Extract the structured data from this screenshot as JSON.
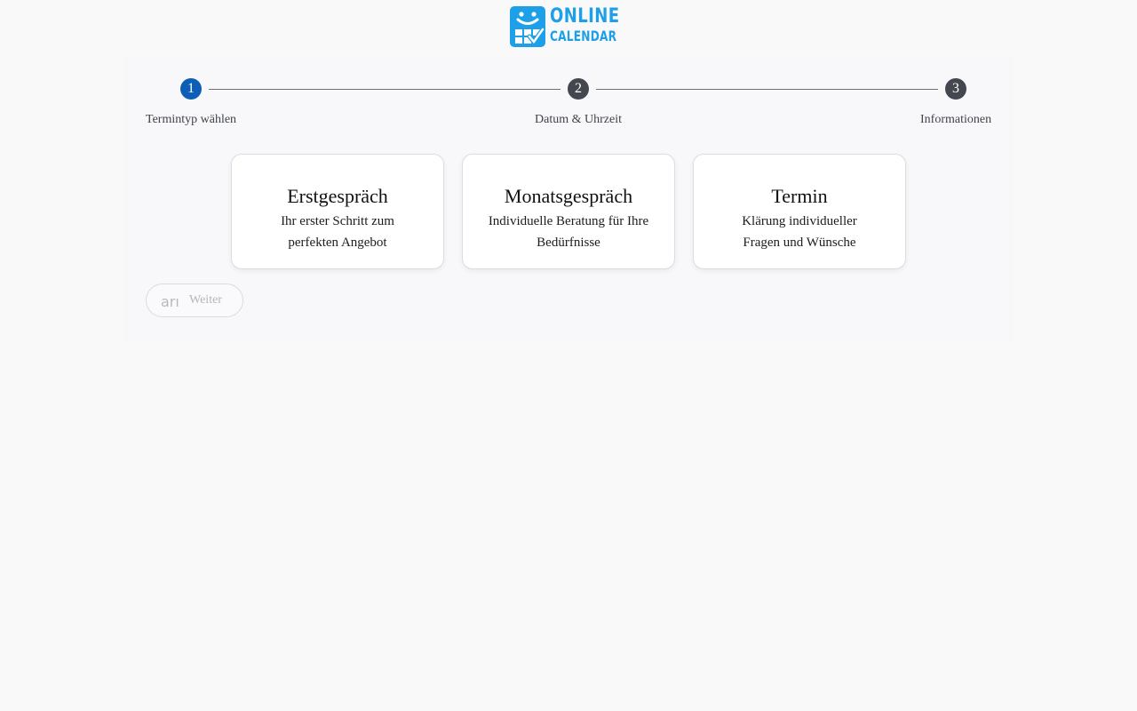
{
  "brand": {
    "line1": "ONLINE",
    "line2": "CALENDAR",
    "color": "#1ea0e8",
    "icon": "smiley-calendar-icon"
  },
  "stepper": {
    "active_color": "#0d5fb6",
    "inactive_color": "#44474f",
    "steps": [
      {
        "number": "1",
        "label": "Termintyp wählen",
        "active": true
      },
      {
        "number": "2",
        "label": "Datum & Uhrzeit",
        "active": false
      },
      {
        "number": "3",
        "label": "Informationen",
        "active": false
      }
    ]
  },
  "options": [
    {
      "title": "Erstgespräch",
      "description": "Ihr erster Schritt zum perfekten Angebot"
    },
    {
      "title": "Monatsgespräch",
      "description": "Individuelle Beratung für Ihre Bedürfnisse"
    },
    {
      "title": "Termin",
      "description": "Klärung individueller Fragen und Wünsche"
    }
  ],
  "next_button": {
    "icon_text": "arı",
    "label": "Weiter",
    "enabled": false
  }
}
